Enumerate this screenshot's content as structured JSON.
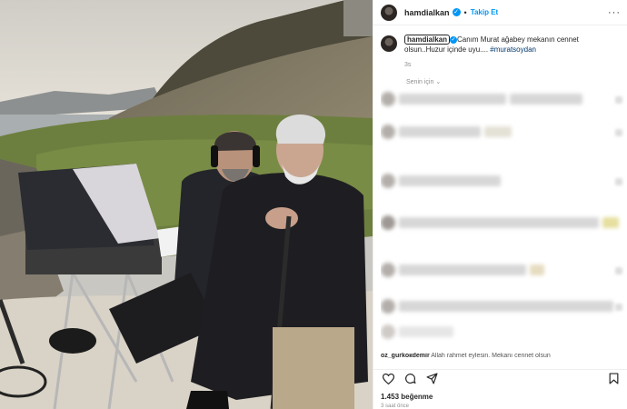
{
  "post": {
    "username": "hamdialkan",
    "verified_mark": "✓",
    "separator": "•",
    "follow_label": "Takip Et",
    "more_icon": "more-icon"
  },
  "caption": {
    "username": "hamdialkan",
    "text": "Canım Murat ağabey mekanın cennet olsun..Huzur içinde uyu.... ",
    "hashtag": "#muratsoydan",
    "time": "3s"
  },
  "comments": {
    "section_label": "Senin için",
    "partial_user": "oz_gurkoкdemir",
    "partial_text": "Allah rahmet eylesin. Mekanı cennet olsun"
  },
  "actions": {
    "like_icon": "heart-icon",
    "comment_icon": "comment-icon",
    "share_icon": "send-icon",
    "save_icon": "bookmark-icon"
  },
  "likes": "1.453 beğenme",
  "posted_ago": "3 saat önce",
  "colors": {
    "accent": "#0095f6",
    "text": "#262626",
    "muted": "#8e8e8e"
  }
}
